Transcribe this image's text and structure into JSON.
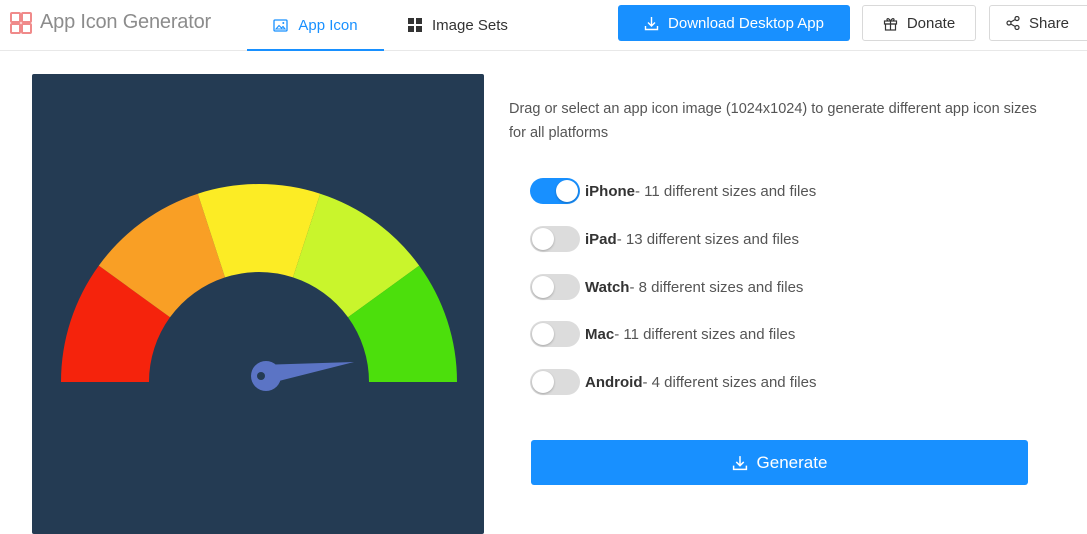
{
  "app": {
    "title": "App Icon Generator",
    "logo_icon": "grid-logo-icon"
  },
  "nav": {
    "tabs": [
      {
        "label": "App Icon",
        "icon": "image-icon",
        "active": true
      },
      {
        "label": "Image Sets",
        "icon": "grid-icon",
        "active": false
      }
    ]
  },
  "header_actions": {
    "download_label": "Download Desktop App",
    "donate_label": "Donate",
    "share_label": "Share"
  },
  "main": {
    "description": "Drag or select an app icon image (1024x1024) to generate different app icon sizes for all platforms",
    "options": [
      {
        "name": "iPhone",
        "detail": " - 11 different sizes and files",
        "enabled": true
      },
      {
        "name": "iPad",
        "detail": " - 13 different sizes and files",
        "enabled": false
      },
      {
        "name": "Watch",
        "detail": " - 8 different sizes and files",
        "enabled": false
      },
      {
        "name": "Mac",
        "detail": " - 11 different sizes and files",
        "enabled": false
      },
      {
        "name": "Android",
        "detail": " - 4 different sizes and files",
        "enabled": false
      }
    ],
    "generate_label": "Generate"
  },
  "colors": {
    "accent": "#1890ff",
    "preview_bg": "#243b53",
    "gauge": [
      "#f5230c",
      "#f99f25",
      "#fcec25",
      "#c9f52c",
      "#4cdf0c"
    ],
    "needle": "#5b74c5"
  }
}
